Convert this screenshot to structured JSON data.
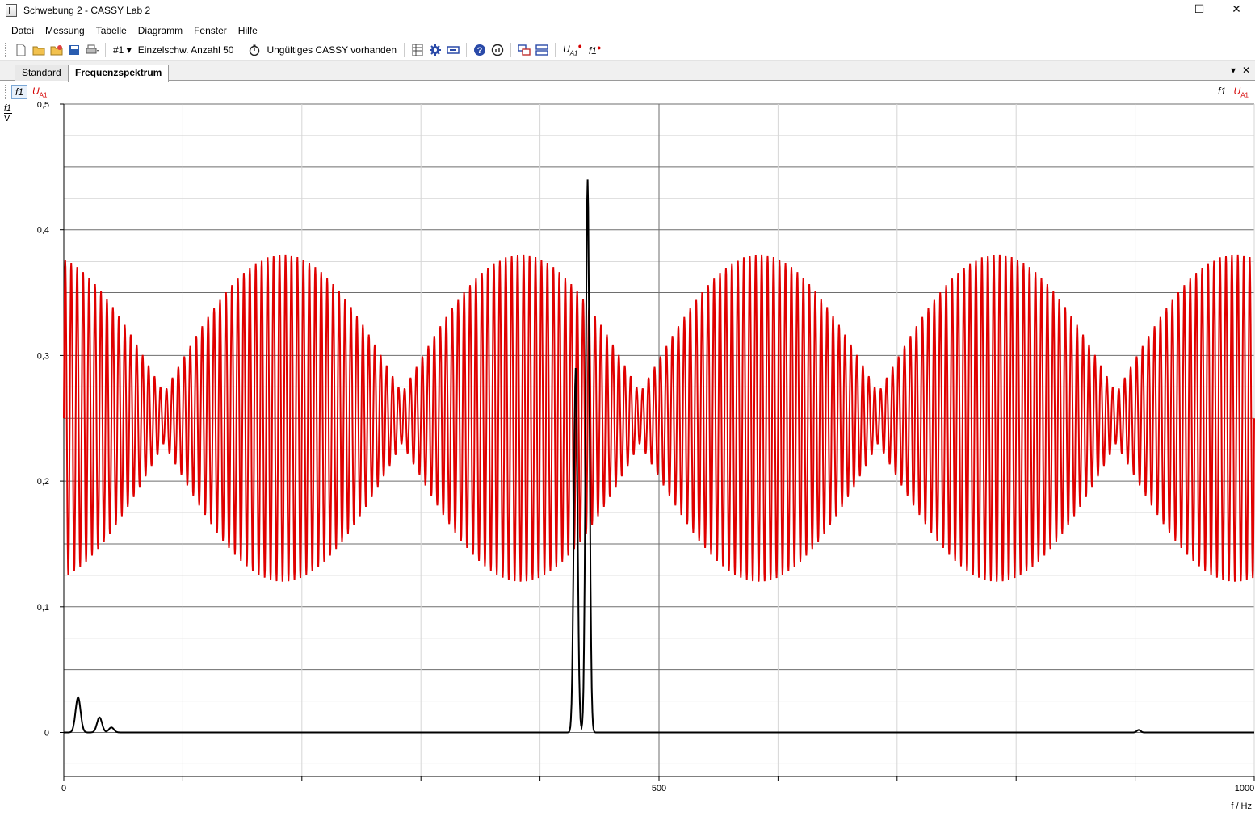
{
  "window": {
    "title": "Schwebung 2 - CASSY Lab 2",
    "minimize": "—",
    "maximize": "☐",
    "close": "✕"
  },
  "menu": [
    "Datei",
    "Messung",
    "Tabelle",
    "Diagramm",
    "Fenster",
    "Hilfe"
  ],
  "toolbar": {
    "channel": "#1",
    "mode": "Einzelschw. Anzahl 50",
    "status": "Ungültiges CASSY vorhanden",
    "u_label": "U",
    "u_sub": "A1",
    "f_label": "f1"
  },
  "tabs": {
    "tab1": "Standard",
    "tab2": "Frequenzspektrum",
    "dropdown": "▾",
    "close": "✕"
  },
  "series_bar": {
    "f1": "f1",
    "u": "U",
    "u_sub": "A1"
  },
  "y_unit": {
    "top": "f1",
    "bottom": "V"
  },
  "x_unit": "f / Hz",
  "colors": {
    "signal": "#e00000",
    "spectrum": "#000000",
    "grid": "#8a8a8a"
  },
  "chart_data": {
    "type": "line",
    "xlabel": "f / Hz",
    "ylabel": "f1 / V",
    "xlim": [
      0,
      1000
    ],
    "ylim": [
      -0.035,
      0.5
    ],
    "x_ticks": [
      0,
      500,
      1000
    ],
    "y_ticks": [
      0,
      0.1,
      0.2,
      0.3,
      0.4,
      0.5
    ],
    "y_tick_labels": [
      "0",
      "0,1",
      "0,2",
      "0,3",
      "0,4",
      "0,5"
    ],
    "grid": true,
    "series": [
      {
        "name": "U A1",
        "color": "#e00000",
        "description_values": {
          "offset": 0.25,
          "carrier_cycles": 200,
          "beat_cycles": 5,
          "amp_max": 0.13,
          "amp_min": 0.02
        }
      },
      {
        "name": "f1",
        "color": "#000000",
        "baseline": 0.0,
        "peaks": [
          {
            "x": 12,
            "y": 0.028
          },
          {
            "x": 30,
            "y": 0.012
          },
          {
            "x": 40,
            "y": 0.004
          },
          {
            "x": 430,
            "y": 0.29
          },
          {
            "x": 440,
            "y": 0.44
          },
          {
            "x": 903,
            "y": 0.002
          }
        ]
      }
    ]
  }
}
